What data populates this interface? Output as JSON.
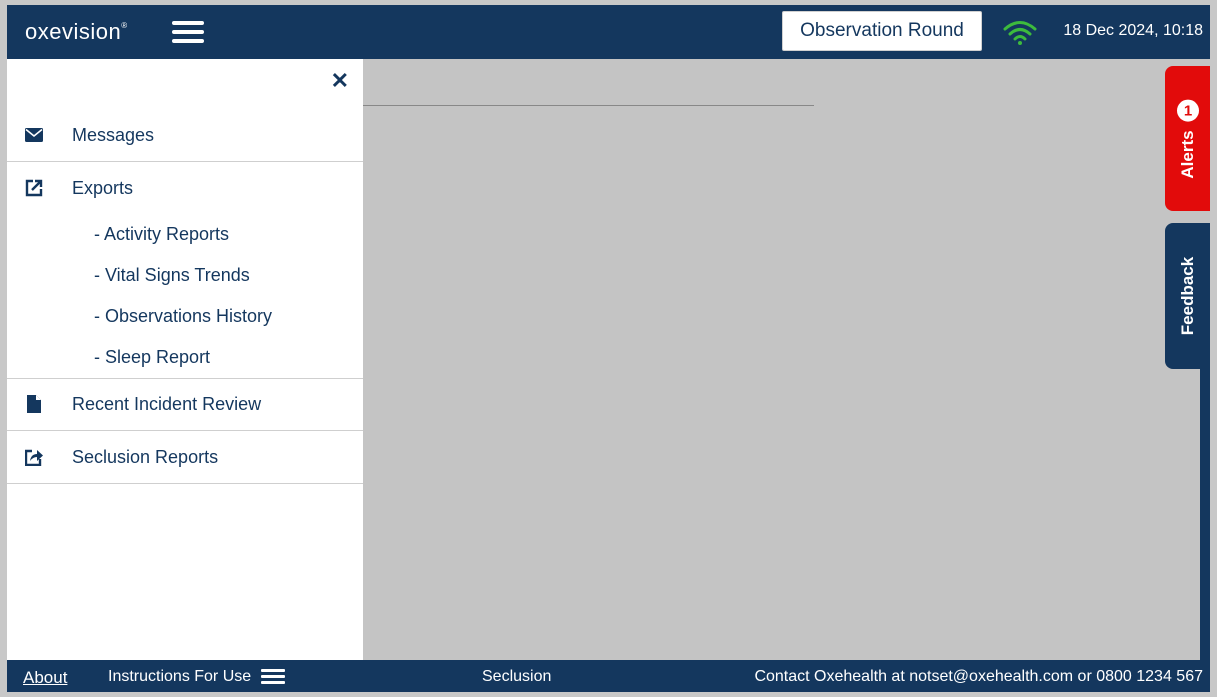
{
  "header": {
    "logo_text": "oxevision",
    "logo_mark": "®",
    "observation_round_label": "Observation Round",
    "datetime": "18 Dec 2024, 10:18",
    "wifi_color": "#3dbb3d"
  },
  "sidebar": {
    "close_label": "✕",
    "items": [
      {
        "label": "Messages",
        "icon": "envelope-icon"
      },
      {
        "label": "Exports",
        "icon": "external-link-icon",
        "subitems": [
          "- Activity Reports",
          "- Vital Signs Trends",
          "- Observations History",
          "- Sleep Report"
        ]
      },
      {
        "label": "Recent Incident Review",
        "icon": "file-icon"
      },
      {
        "label": "Seclusion Reports",
        "icon": "share-icon"
      }
    ]
  },
  "tabs": {
    "alerts_label": "Alerts",
    "alerts_count": "1",
    "feedback_label": "Feedback"
  },
  "footer": {
    "about": "About",
    "instructions": "Instructions For Use",
    "center": "Seclusion",
    "contact": "Contact Oxehealth at notset@oxehealth.com or 0800 1234 567"
  },
  "colors": {
    "navy": "#14375e",
    "alert_red": "#e20b0b",
    "content_grey": "#c4c4c4"
  }
}
